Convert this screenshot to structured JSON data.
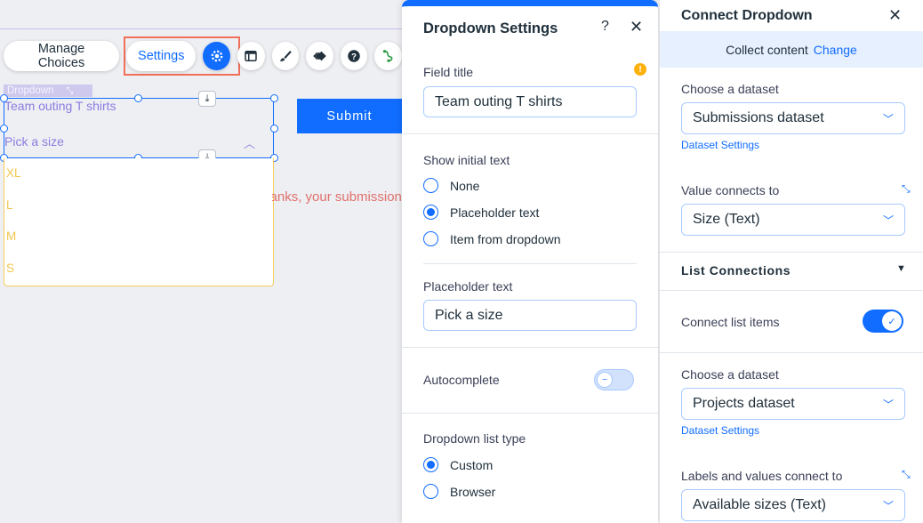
{
  "canvas": {
    "toolbar": {
      "manage_choices_label": "Manage Choices",
      "settings_label": "Settings",
      "icons": [
        "gear-icon",
        "layout-icon",
        "brush-icon",
        "animation-icon",
        "help-icon",
        "connect-data-icon"
      ]
    },
    "component_tag": "Dropdown",
    "field_title": "Team outing T shirts",
    "placeholder": "Pick a size",
    "options": [
      "XL",
      "L",
      "M",
      "S"
    ],
    "submit_label": "Submit",
    "success_message": "Thanks, your submission has been submitted"
  },
  "dropdown_settings": {
    "title": "Dropdown Settings",
    "help_glyph": "?",
    "close_glyph": "✕",
    "field_title_label": "Field title",
    "field_title_value": "Team outing T shirts",
    "show_initial_text_label": "Show initial text",
    "initial_text_options": [
      {
        "label": "None",
        "checked": false
      },
      {
        "label": "Placeholder text",
        "checked": true
      },
      {
        "label": "Item from dropdown",
        "checked": false
      }
    ],
    "placeholder_label": "Placeholder text",
    "placeholder_value": "Pick a size",
    "autocomplete_label": "Autocomplete",
    "autocomplete_on": false,
    "list_type_label": "Dropdown list type",
    "list_type_options": [
      {
        "label": "Custom",
        "checked": true
      },
      {
        "label": "Browser",
        "checked": false
      }
    ]
  },
  "connect_dropdown": {
    "title": "Connect Dropdown",
    "close_glyph": "✕",
    "collect_text": "Collect content",
    "change_link": "Change",
    "choose_dataset_label": "Choose a dataset",
    "dataset_value": "Submissions dataset",
    "dataset_settings_link": "Dataset Settings",
    "value_connects_label": "Value connects to",
    "value_connects_value": "Size (Text)",
    "list_connections_label": "List Connections",
    "connect_list_items_label": "Connect list items",
    "connect_list_items_on": true,
    "choose_dataset_label_2": "Choose a dataset",
    "dataset_value_2": "Projects dataset",
    "dataset_settings_link_2": "Dataset Settings",
    "labels_values_label": "Labels and values connect to",
    "labels_values_value": "Available sizes (Text)"
  },
  "colors": {
    "accent": "#116dff",
    "highlight": "#f2705a",
    "option_text": "#f1c74a",
    "field_text": "#8a7de0"
  }
}
